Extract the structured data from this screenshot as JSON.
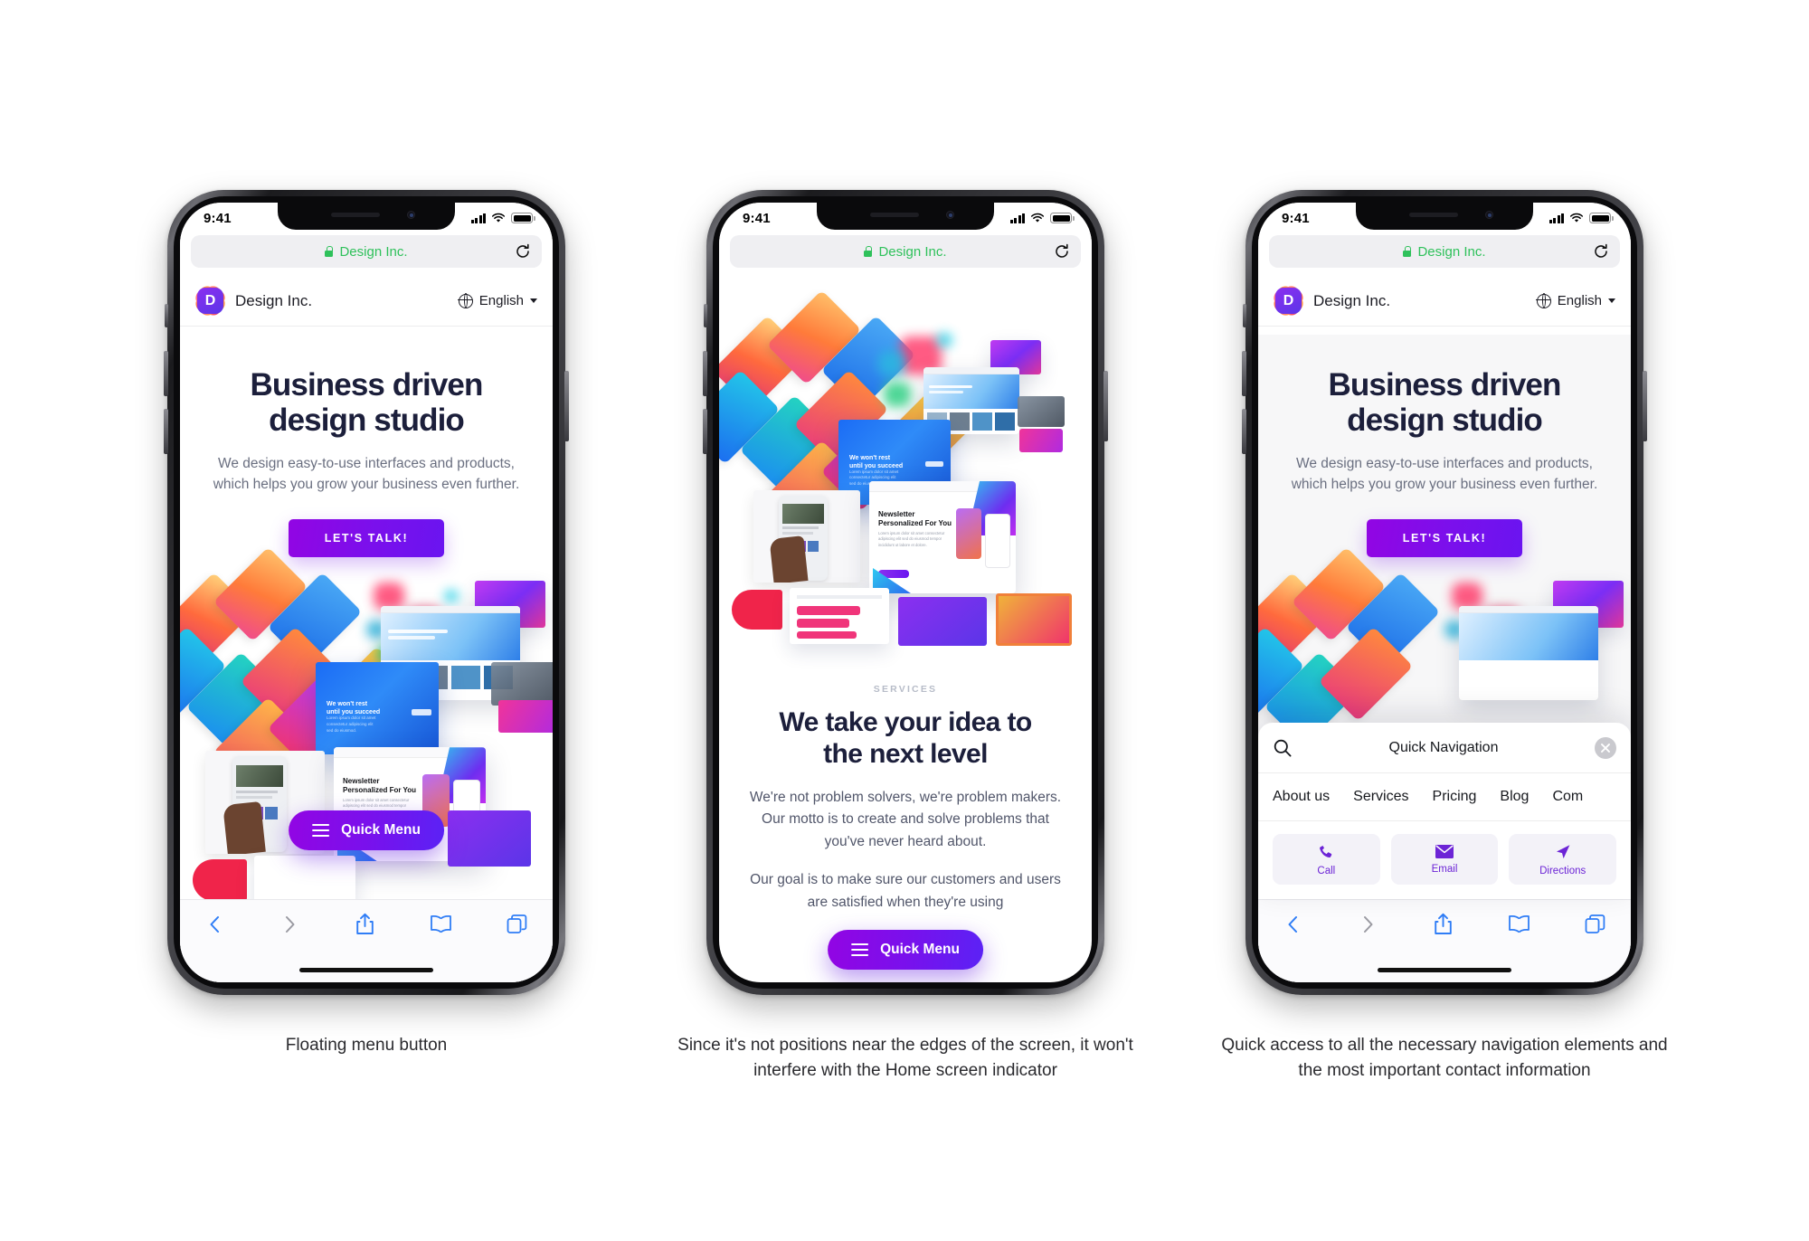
{
  "statusbar": {
    "time": "9:41",
    "signal_icon": "cellular-signal-icon",
    "wifi_icon": "wifi-icon",
    "battery_icon": "battery-icon"
  },
  "browser": {
    "url_text": "Design Inc.",
    "lock_icon": "lock-icon",
    "reload_icon": "reload-icon",
    "toolbar": {
      "back_icon": "chevron-left-icon",
      "forward_icon": "chevron-right-icon",
      "share_icon": "share-icon",
      "bookmarks_icon": "book-icon",
      "tabs_icon": "tabs-icon"
    }
  },
  "site": {
    "brand": "Design Inc.",
    "logo_letter": "D",
    "language": "English",
    "globe_icon": "globe-icon",
    "caret_icon": "chevron-down-icon"
  },
  "hero": {
    "title_line1": "Business driven",
    "title_line2": "design studio",
    "body": "We design easy-to-use interfaces and products, which helps you grow your business even further.",
    "cta_label": "LET'S TALK!"
  },
  "services": {
    "eyebrow": "SERVICES",
    "title_line1": "We take your idea to",
    "title_line2": "the next level",
    "paragraph1": "We're not problem solvers, we're problem makers. Our motto is to create and solve problems that you've never heard about.",
    "paragraph2": "Our goal is to make sure our customers and users are satisfied when they're using"
  },
  "quick_menu": {
    "label": "Quick Menu",
    "icon": "hamburger-icon"
  },
  "quick_nav": {
    "title": "Quick Navigation",
    "search_icon": "search-icon",
    "close_icon": "close-icon",
    "links": [
      "About us",
      "Services",
      "Pricing",
      "Blog",
      "Com"
    ],
    "actions": [
      {
        "label": "Call",
        "icon": "phone-icon"
      },
      {
        "label": "Email",
        "icon": "envelope-icon"
      },
      {
        "label": "Directions",
        "icon": "navigation-arrow-icon"
      }
    ]
  },
  "captions": {
    "one": "Floating menu button",
    "two": "Since it's not positions near the edges of the screen, it won't interfere with the Home screen indicator",
    "three": "Quick access to all the necessary navigation elements and the most important contact information"
  },
  "colors": {
    "accent_purple": "#7a10ec",
    "accent_violet": "#9205e3",
    "link_blue": "#2f7df6",
    "secure_green": "#2fc15b",
    "heading_navy": "#1c1f3b",
    "body_grey": "#6a6f80",
    "action_purple": "#6c24d6"
  }
}
